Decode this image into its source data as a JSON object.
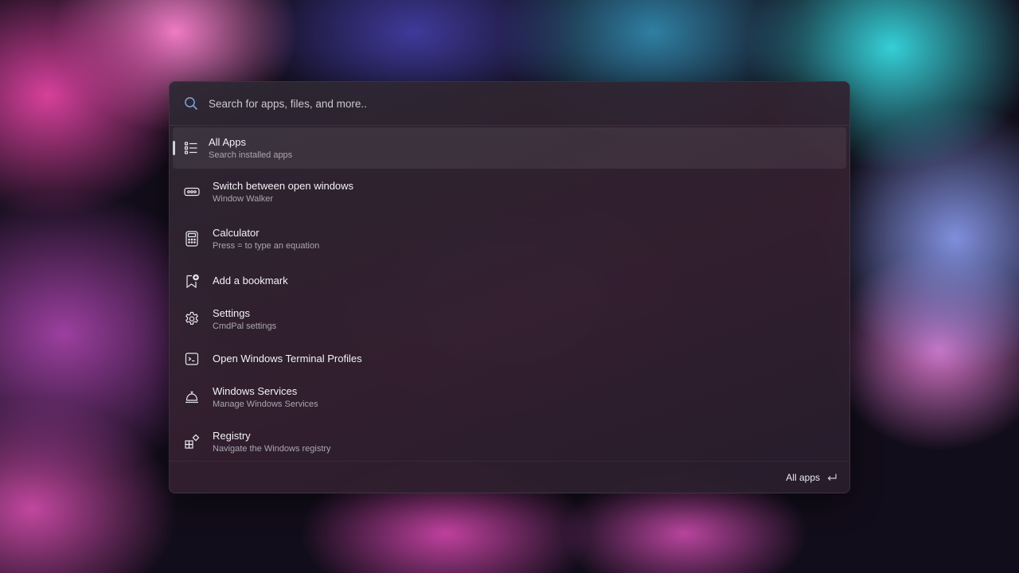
{
  "search": {
    "placeholder": "Search for apps, files, and more.."
  },
  "results": [
    {
      "title": "All Apps",
      "subtitle": "Search installed apps",
      "icon": "list-icon"
    },
    {
      "title": "Switch between open windows",
      "subtitle": "Window Walker",
      "icon": "window-switch-icon"
    },
    {
      "title": "Calculator",
      "subtitle": "Press = to type an equation",
      "icon": "calculator-icon"
    },
    {
      "title": "Add a bookmark",
      "subtitle": "",
      "icon": "bookmark-add-icon"
    },
    {
      "title": "Settings",
      "subtitle": "CmdPal settings",
      "icon": "gear-icon"
    },
    {
      "title": "Open Windows Terminal Profiles",
      "subtitle": "",
      "icon": "terminal-icon"
    },
    {
      "title": "Windows Services",
      "subtitle": "Manage Windows Services",
      "icon": "service-bell-icon"
    },
    {
      "title": "Registry",
      "subtitle": "Navigate the Windows registry",
      "icon": "registry-icon"
    }
  ],
  "footer": {
    "action_label": "All apps",
    "action_key_icon": "enter-key-icon"
  },
  "colors": {
    "text_primary": "#f2f2f4",
    "text_secondary": "#a9a7ae",
    "palette_bg": "#2c2832"
  }
}
